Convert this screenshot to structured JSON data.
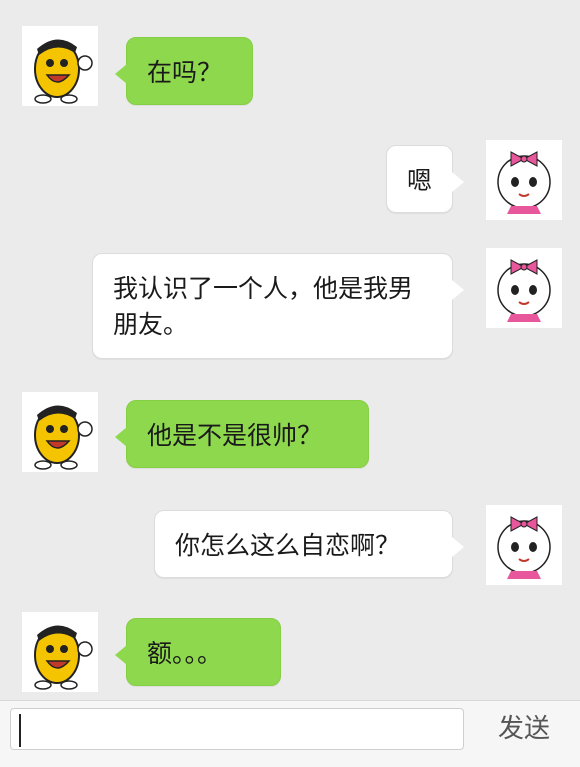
{
  "messages": [
    {
      "side": "left",
      "avatar_icon": "bean-mascot-icon",
      "text": "在吗？"
    },
    {
      "side": "right",
      "avatar_icon": "girl-face-icon",
      "text": "嗯"
    },
    {
      "side": "right",
      "avatar_icon": "girl-face-icon",
      "text": "我认识了一个人，他是我男朋友。"
    },
    {
      "side": "left",
      "avatar_icon": "bean-mascot-icon",
      "text": "他是不是很帅？"
    },
    {
      "side": "right",
      "avatar_icon": "girl-face-icon",
      "text": "你怎么这么自恋啊？"
    },
    {
      "side": "left",
      "avatar_icon": "bean-mascot-icon",
      "text": "额。。。"
    }
  ],
  "input": {
    "value": "",
    "placeholder": ""
  },
  "send_label": "发送",
  "colors": {
    "background": "#ebebeb",
    "bubble_sent": "#8ed84d",
    "bubble_received": "#ffffff"
  }
}
